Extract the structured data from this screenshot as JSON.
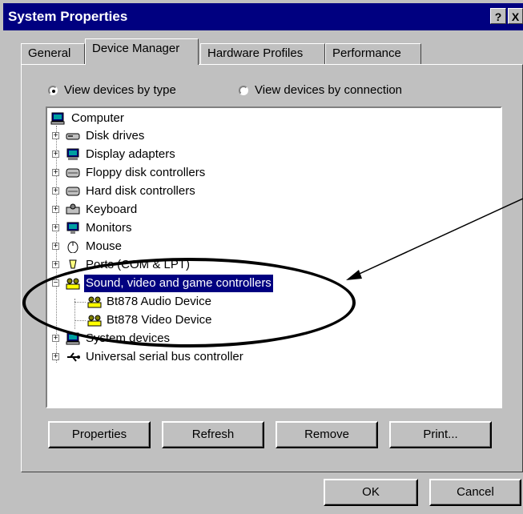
{
  "window": {
    "title": "System Properties",
    "help_btn": "?",
    "close_btn": "X"
  },
  "tabs": [
    {
      "label": "General",
      "active": false
    },
    {
      "label": "Device Manager",
      "active": true
    },
    {
      "label": "Hardware Profiles",
      "active": false
    },
    {
      "label": "Performance",
      "active": false
    }
  ],
  "view": {
    "by_type": "View devices by type",
    "by_connection": "View devices by connection",
    "selected": "by_type"
  },
  "tree": {
    "root": "Computer",
    "items": [
      {
        "label": "Disk drives",
        "icon": "disk-drive-icon",
        "expander": "+"
      },
      {
        "label": "Display adapters",
        "icon": "display-adapter-icon",
        "expander": "+"
      },
      {
        "label": "Floppy disk controllers",
        "icon": "floppy-controller-icon",
        "expander": "+"
      },
      {
        "label": "Hard disk controllers",
        "icon": "hard-disk-controller-icon",
        "expander": "+"
      },
      {
        "label": "Keyboard",
        "icon": "keyboard-icon",
        "expander": "+"
      },
      {
        "label": "Monitors",
        "icon": "monitor-icon",
        "expander": "+"
      },
      {
        "label": "Mouse",
        "icon": "mouse-icon",
        "expander": "+"
      },
      {
        "label": "Ports (COM & LPT)",
        "icon": "port-icon",
        "expander": "+"
      },
      {
        "label": "Sound, video and game controllers",
        "icon": "sound-controller-icon",
        "expander": "−",
        "selected": true,
        "children": [
          {
            "label": "Bt878 Audio Device",
            "icon": "audio-device-icon"
          },
          {
            "label": "Bt878 Video Device",
            "icon": "video-device-icon"
          }
        ]
      },
      {
        "label": "System devices",
        "icon": "system-devices-icon",
        "expander": "+"
      },
      {
        "label": "Universal serial bus controller",
        "icon": "usb-icon",
        "expander": "+"
      }
    ]
  },
  "buttons": {
    "properties": "Properties",
    "refresh": "Refresh",
    "remove": "Remove",
    "print": "Print...",
    "ok": "OK",
    "cancel": "Cancel"
  },
  "colors": {
    "titlebar": "#000080",
    "face": "#c0c0c0",
    "selection": "#000080"
  }
}
